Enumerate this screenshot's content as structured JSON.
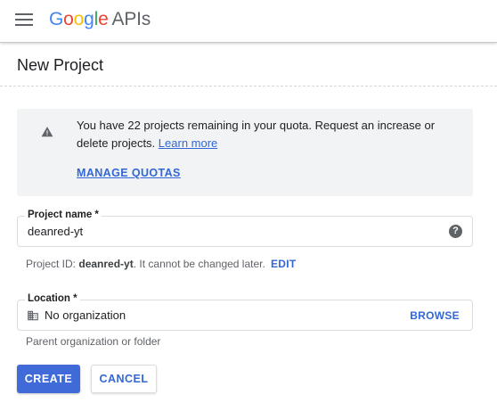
{
  "header": {
    "brand_letters": [
      {
        "char": "G",
        "color": "#4285F4"
      },
      {
        "char": "o",
        "color": "#EA4335"
      },
      {
        "char": "o",
        "color": "#FBBC05"
      },
      {
        "char": "g",
        "color": "#4285F4"
      },
      {
        "char": "l",
        "color": "#34A853"
      },
      {
        "char": "e",
        "color": "#EA4335"
      }
    ],
    "brand": "Google",
    "product": "APIs",
    "menu_icon": "hamburger-menu-icon"
  },
  "page": {
    "title": "New Project"
  },
  "quota": {
    "icon": "warning-icon",
    "message": "You have 22 projects remaining in your quota. Request an increase or delete projects.",
    "learn_more": "Learn more",
    "manage_quotas": "MANAGE QUOTAS"
  },
  "project_name": {
    "label": "Project name *",
    "value": "deanred-yt",
    "help_icon": "help-icon"
  },
  "project_id": {
    "prefix": "Project ID:",
    "id": "deanred-yt",
    "suffix": ". It cannot be changed later.",
    "edit": "EDIT"
  },
  "location": {
    "label": "Location *",
    "value": "No organization",
    "icon": "organization-icon",
    "browse": "BROWSE",
    "help": "Parent organization or folder"
  },
  "actions": {
    "create": "CREATE",
    "cancel": "CANCEL"
  },
  "colors": {
    "accent": "#3367d6",
    "primary_button": "#3f6ad8",
    "quota_background": "#f1f3f4"
  }
}
